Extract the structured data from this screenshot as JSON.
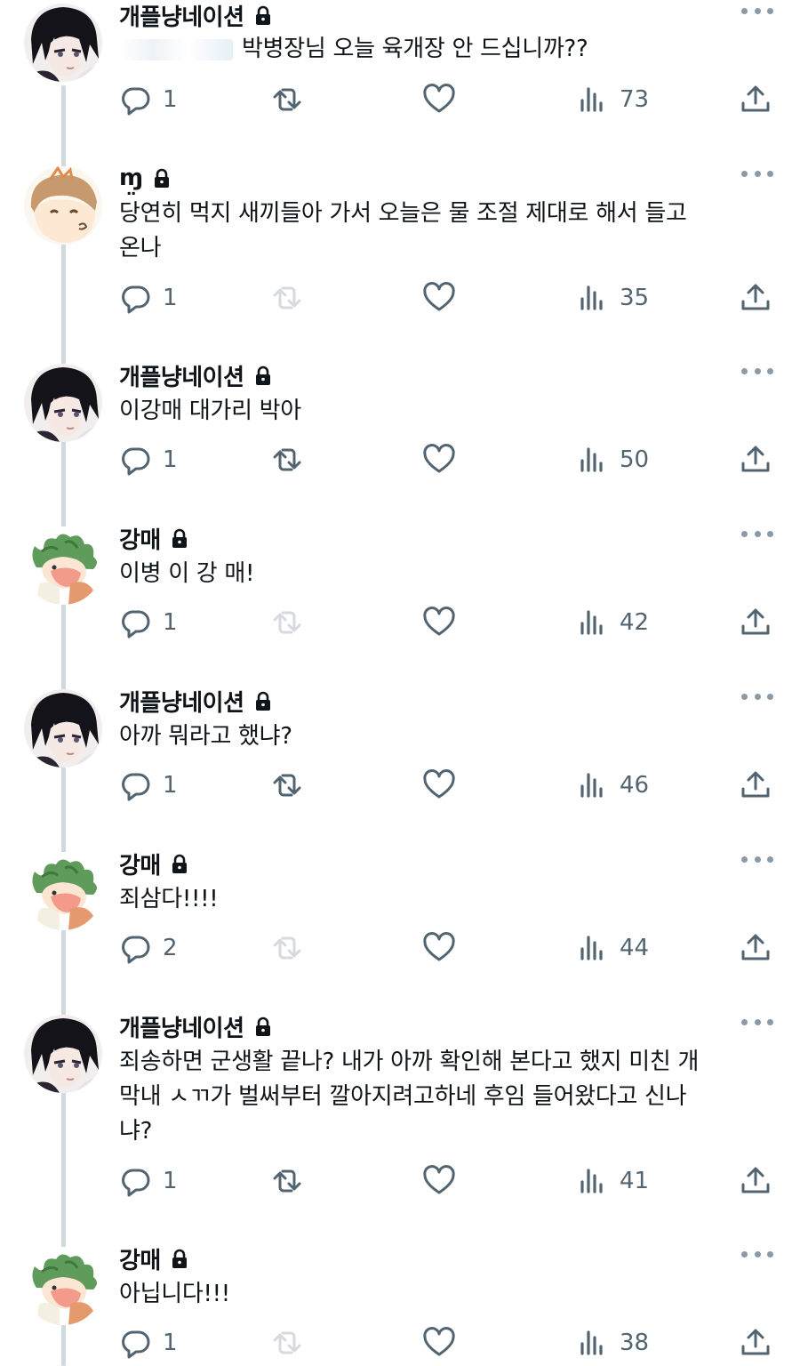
{
  "users": {
    "kaepleul": {
      "name": "개플냥네이션"
    },
    "mm": {
      "name": "ɱ̤"
    },
    "gangmae": {
      "name": "강매"
    }
  },
  "tweets": [
    {
      "user": "개플냥네이션",
      "text": "박병장님 오늘 육개장 안 드십니까??",
      "reply": "1",
      "views": "73"
    },
    {
      "user": "ɱ̤",
      "text": "당연히 먹지 새끼들아 가서 오늘은 물 조절 제대로 해서 들고\n온나",
      "reply": "1",
      "views": "35"
    },
    {
      "user": "개플냥네이션",
      "text": "이강매 대가리 박아",
      "reply": "1",
      "views": "50"
    },
    {
      "user": "강매",
      "text": "이병 이 강 매!",
      "reply": "1",
      "views": "42"
    },
    {
      "user": "개플냥네이션",
      "text": "아까 뭐라고 했냐?",
      "reply": "1",
      "views": "46"
    },
    {
      "user": "강매",
      "text": "죄삼다!!!!",
      "reply": "2",
      "views": "44"
    },
    {
      "user": "개플냥네이션",
      "text": "죄송하면 군생활 끝나? 내가 아까 확인해 본다고 했지 미친 개\n막내 ㅅㄲ가 벌써부터 깔아지려고하네 후임 들어왔다고 신나\n냐?",
      "reply": "1",
      "views": "41"
    },
    {
      "user": "강매",
      "text": "아닙니다!!!",
      "reply": "1",
      "views": "38"
    }
  ],
  "icons": {
    "reply": "reply-icon",
    "retweet": "retweet-icon",
    "like": "heart-icon",
    "views": "views-icon",
    "share": "share-icon",
    "lock": "lock-icon",
    "more": "more-icon"
  },
  "colors": {
    "icon": "#536471",
    "text": "#0f1419",
    "thread_line": "#cfd9de"
  }
}
